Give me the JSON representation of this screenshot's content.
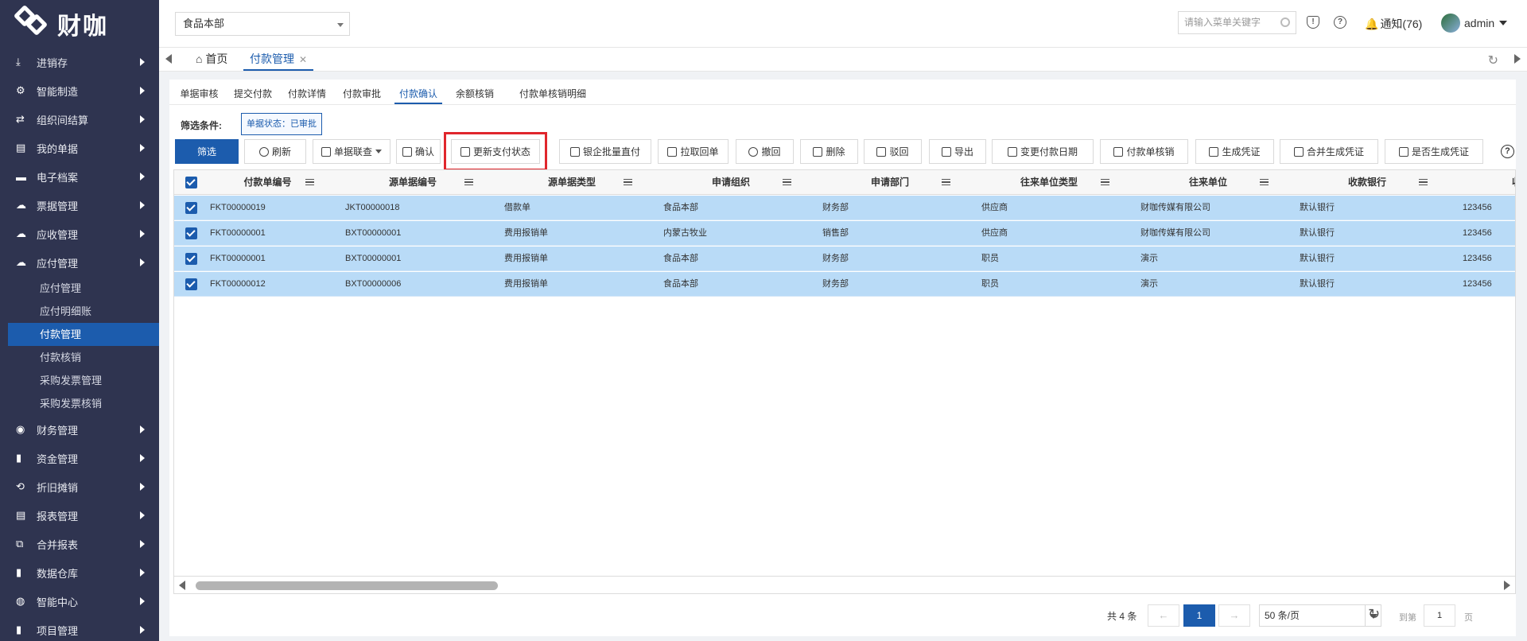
{
  "brand": {
    "name": "财咖"
  },
  "sidebar": {
    "items_top": [
      {
        "label": "进销存",
        "icon": "download-icon",
        "glyph": "⤓"
      },
      {
        "label": "智能制造",
        "icon": "gears-icon",
        "glyph": "⚙"
      },
      {
        "label": "组织间结算",
        "icon": "exchange-icon",
        "glyph": "⇄"
      },
      {
        "label": "我的单据",
        "icon": "clipboard-icon",
        "glyph": "▤"
      },
      {
        "label": "电子档案",
        "icon": "archive-icon",
        "glyph": "▬"
      },
      {
        "label": "票据管理",
        "icon": "cloud-upload-icon",
        "glyph": "☁"
      },
      {
        "label": "应收管理",
        "icon": "cloud-upload-icon",
        "glyph": "☁"
      },
      {
        "label": "应付管理",
        "icon": "cloud-download-icon",
        "glyph": "☁"
      }
    ],
    "sub_items": [
      {
        "label": "应付管理",
        "active": false
      },
      {
        "label": "应付明细账",
        "active": false
      },
      {
        "label": "付款管理",
        "active": true
      },
      {
        "label": "付款核销",
        "active": false
      },
      {
        "label": "采购发票管理",
        "active": false
      },
      {
        "label": "采购发票核销",
        "active": false
      }
    ],
    "items_bottom": [
      {
        "label": "财务管理",
        "icon": "finance-icon",
        "glyph": "◉"
      },
      {
        "label": "资金管理",
        "icon": "bar-chart-icon",
        "glyph": "▮"
      },
      {
        "label": "折旧摊销",
        "icon": "repeat-icon",
        "glyph": "⟲"
      },
      {
        "label": "报表管理",
        "icon": "report-icon",
        "glyph": "▤"
      },
      {
        "label": "合并报表",
        "icon": "merge-icon",
        "glyph": "⧉"
      },
      {
        "label": "数据仓库",
        "icon": "bar-chart-icon",
        "glyph": "▮"
      },
      {
        "label": "智能中心",
        "icon": "globe-icon",
        "glyph": "◍"
      },
      {
        "label": "项目管理",
        "icon": "bar-chart-icon",
        "glyph": "▮"
      }
    ]
  },
  "topbar": {
    "org": "食品本部",
    "search_placeholder": "请输入菜单关键字",
    "notice": "通知(76)",
    "user": "admin"
  },
  "tabs": {
    "home": "首页",
    "current": "付款管理"
  },
  "subtabs": [
    "单据审核",
    "提交付款",
    "付款详情",
    "付款审批",
    "付款确认",
    "余额核销",
    "付款单核销明细"
  ],
  "active_subtab": "付款确认",
  "filter": {
    "label": "筛选条件:",
    "tag": "单据状态：已审批"
  },
  "toolbar": {
    "buttons": [
      "筛选",
      "刷新",
      "单据联查",
      "确认",
      "更新支付状态",
      "银企批量直付",
      "拉取回单",
      "撤回",
      "删除",
      "驳回",
      "导出",
      "变更付款日期",
      "付款单核销",
      "生成凭证",
      "合并生成凭证",
      "是否生成凭证"
    ]
  },
  "grid": {
    "columns": [
      "付款单编号",
      "源单据编号",
      "源单据类型",
      "申请组织",
      "申请部门",
      "往来单位类型",
      "往来单位",
      "收款银行",
      "收"
    ],
    "rows": [
      [
        "FKT00000019",
        "JKT00000018",
        "借款单",
        "食品本部",
        "财务部",
        "供应商",
        "财咖传媒有限公司",
        "默认银行",
        "123456"
      ],
      [
        "FKT00000001",
        "BXT00000001",
        "费用报销单",
        "内蒙古牧业",
        "销售部",
        "供应商",
        "财咖传媒有限公司",
        "默认银行",
        "123456"
      ],
      [
        "FKT00000001",
        "BXT00000001",
        "费用报销单",
        "食品本部",
        "财务部",
        "职员",
        "演示",
        "默认银行",
        "123456"
      ],
      [
        "FKT00000012",
        "BXT00000006",
        "费用报销单",
        "食品本部",
        "财务部",
        "职员",
        "演示",
        "默认银行",
        "123456"
      ]
    ]
  },
  "pager": {
    "total": "共 4 条",
    "prev": "←",
    "current_page": "1",
    "next": "→",
    "page_size": "50 条/页",
    "goto": "到第",
    "goto_value": "1",
    "page_unit": "页"
  },
  "colors": {
    "accent": "#1c5cad",
    "sidebar": "#2f3450",
    "row_selected": "#b9dbf7",
    "highlight_box": "#e0262c"
  }
}
